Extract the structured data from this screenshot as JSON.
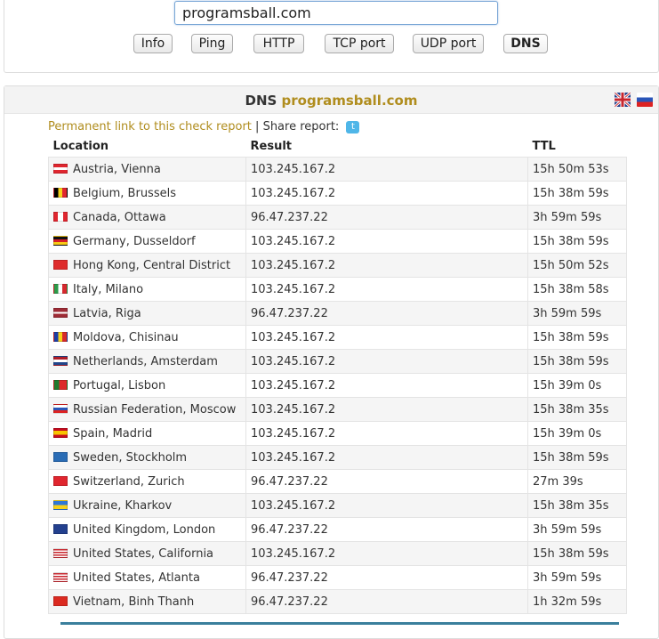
{
  "search": {
    "value": "programsball.com"
  },
  "buttons": [
    "Info",
    "Ping",
    "HTTP",
    "TCP port",
    "UDP port",
    "DNS"
  ],
  "active_button": "DNS",
  "result": {
    "title_prefix": "DNS",
    "title_host": "programsball.com",
    "permalink": "Permanent link to this check report",
    "separator": "|",
    "share_label": "Share report:",
    "languages": [
      "english-flag-icon",
      "russian-flag-icon"
    ]
  },
  "table": {
    "headers": [
      "Location",
      "Result",
      "TTL"
    ],
    "rows": [
      {
        "flag": "at",
        "location": "Austria, Vienna",
        "result": "103.245.167.2",
        "ttl": "15h 50m 53s"
      },
      {
        "flag": "be",
        "location": "Belgium, Brussels",
        "result": "103.245.167.2",
        "ttl": "15h 38m 59s"
      },
      {
        "flag": "ca",
        "location": "Canada, Ottawa",
        "result": "96.47.237.22",
        "ttl": "3h 59m 59s"
      },
      {
        "flag": "de",
        "location": "Germany, Dusseldorf",
        "result": "103.245.167.2",
        "ttl": "15h 38m 59s"
      },
      {
        "flag": "hk",
        "location": "Hong Kong, Central District",
        "result": "103.245.167.2",
        "ttl": "15h 50m 52s"
      },
      {
        "flag": "it",
        "location": "Italy, Milano",
        "result": "103.245.167.2",
        "ttl": "15h 38m 58s"
      },
      {
        "flag": "lv",
        "location": "Latvia, Riga",
        "result": "96.47.237.22",
        "ttl": "3h 59m 59s"
      },
      {
        "flag": "md",
        "location": "Moldova, Chisinau",
        "result": "103.245.167.2",
        "ttl": "15h 38m 59s"
      },
      {
        "flag": "nl",
        "location": "Netherlands, Amsterdam",
        "result": "103.245.167.2",
        "ttl": "15h 38m 59s"
      },
      {
        "flag": "pt",
        "location": "Portugal, Lisbon",
        "result": "103.245.167.2",
        "ttl": "15h 39m 0s"
      },
      {
        "flag": "ru",
        "location": "Russian Federation, Moscow",
        "result": "103.245.167.2",
        "ttl": "15h 38m 35s"
      },
      {
        "flag": "es",
        "location": "Spain, Madrid",
        "result": "103.245.167.2",
        "ttl": "15h 39m 0s"
      },
      {
        "flag": "se",
        "location": "Sweden, Stockholm",
        "result": "103.245.167.2",
        "ttl": "15h 38m 59s"
      },
      {
        "flag": "ch",
        "location": "Switzerland, Zurich",
        "result": "96.47.237.22",
        "ttl": "27m 39s"
      },
      {
        "flag": "ua",
        "location": "Ukraine, Kharkov",
        "result": "103.245.167.2",
        "ttl": "15h 38m 35s"
      },
      {
        "flag": "gb",
        "location": "United Kingdom, London",
        "result": "96.47.237.22",
        "ttl": "3h 59m 59s"
      },
      {
        "flag": "us",
        "location": "United States, California",
        "result": "103.245.167.2",
        "ttl": "15h 38m 59s"
      },
      {
        "flag": "us",
        "location": "United States, Atlanta",
        "result": "96.47.237.22",
        "ttl": "3h 59m 59s"
      },
      {
        "flag": "vn",
        "location": "Vietnam, Binh Thanh",
        "result": "96.47.237.22",
        "ttl": "1h 32m 59s"
      }
    ]
  }
}
